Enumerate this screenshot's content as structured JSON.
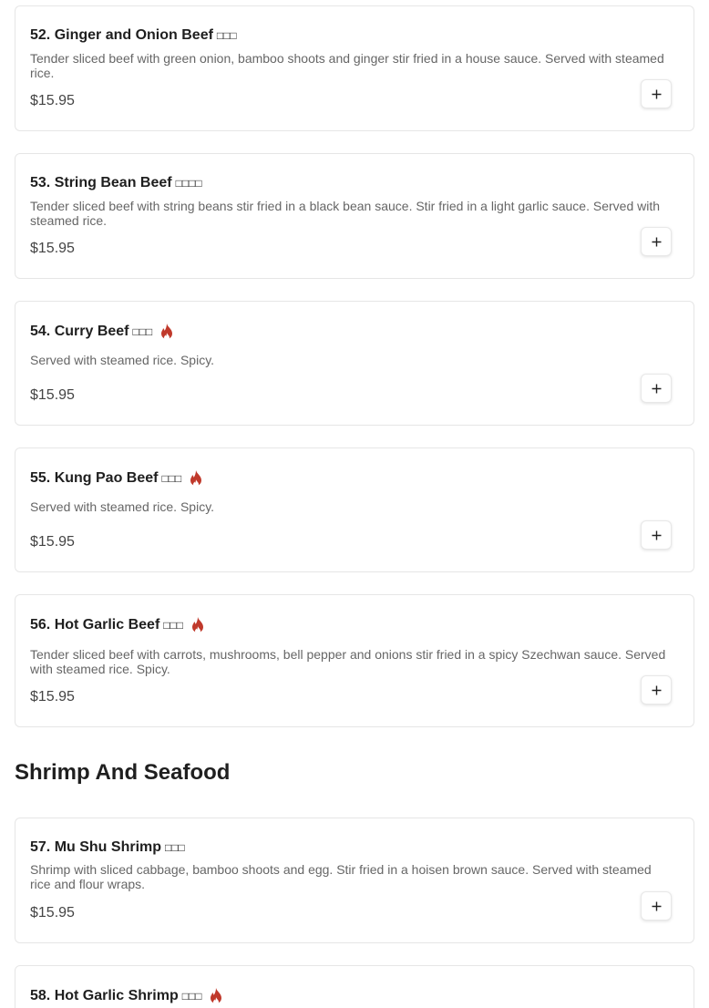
{
  "colors": {
    "spicy": "#c0392b",
    "border": "#e6e6e6",
    "desc": "#666666"
  },
  "items": [
    {
      "name": "52. Ginger and Onion Beef",
      "cn": "□□□",
      "desc": "Tender sliced beef with green onion, bamboo shoots and ginger stir fried in a house sauce. Served with steamed rice.",
      "price": "$15.95",
      "spicy": false,
      "add_icon": "plus-icon"
    },
    {
      "name": "53. String Bean Beef",
      "cn": "□□□□",
      "desc": "Tender sliced beef with string beans stir fried in a black bean sauce. Stir fried in a light garlic sauce. Served with steamed rice.",
      "price": "$15.95",
      "spicy": false,
      "add_icon": "plus-icon"
    },
    {
      "name": "54. Curry Beef",
      "cn": "□□□",
      "desc": "Served with steamed rice. Spicy.",
      "price": "$15.95",
      "spicy": true,
      "add_icon": "plus-icon"
    },
    {
      "name": "55. Kung Pao Beef",
      "cn": "□□□",
      "desc": "Served with steamed rice. Spicy.",
      "price": "$15.95",
      "spicy": true,
      "add_icon": "plus-icon"
    },
    {
      "name": "56. Hot Garlic Beef",
      "cn": "□□□",
      "desc": "Tender sliced beef with carrots, mushrooms, bell pepper and onions stir fried in a spicy Szechwan sauce. Served with steamed rice. Spicy.",
      "price": "$15.95",
      "spicy": true,
      "add_icon": "plus-icon"
    }
  ],
  "section": {
    "title": "Shrimp And Seafood"
  },
  "items2": [
    {
      "name": "57. Mu Shu Shrimp",
      "cn": "□□□",
      "desc": "Shrimp with sliced cabbage, bamboo shoots and egg. Stir fried in a hoisen brown sauce. Served with steamed rice and flour wraps.",
      "price": "$15.95",
      "spicy": false,
      "add_icon": "plus-icon"
    },
    {
      "name": "58. Hot Garlic Shrimp",
      "cn": "□□□",
      "spicy": true
    }
  ]
}
